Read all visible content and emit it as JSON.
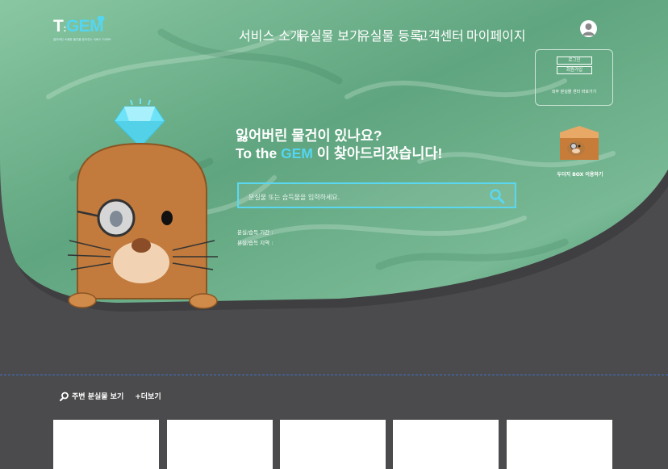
{
  "brand": {
    "logo_prefix": "T",
    "logo_name": "GEM",
    "tagline": "잃어버린 소중한 물건을 찾아주는 서비스 T:GEM"
  },
  "nav": {
    "items": [
      "서비스 소개",
      "유실물 보기",
      "유실물 등록",
      "고객센터",
      "마이페이지"
    ]
  },
  "account": {
    "login": "로그인",
    "signup": "회원가입",
    "center_link": "외부 분실물 센터 바로가기"
  },
  "box": {
    "label": "두더지 BOX 이용하기"
  },
  "hero": {
    "line1": "잃어버린 물건이 있나요?",
    "line2_prefix": "To the ",
    "line2_gem": "GEM",
    "line2_suffix": " 이 찾아드리겠습니다!"
  },
  "search": {
    "placeholder": "분실물 또는 습득물을 입력하세요."
  },
  "filters": {
    "period_label": "분실/습득 기간 :",
    "region_label": "분실/습득 지역 :"
  },
  "nearby": {
    "title": "주변 분실물 보기",
    "more": "+더보기"
  },
  "colors": {
    "accent": "#54d6f2",
    "background": "#4b4b4d",
    "hero_green": "#6fb08c",
    "divider": "#3f73c8"
  }
}
